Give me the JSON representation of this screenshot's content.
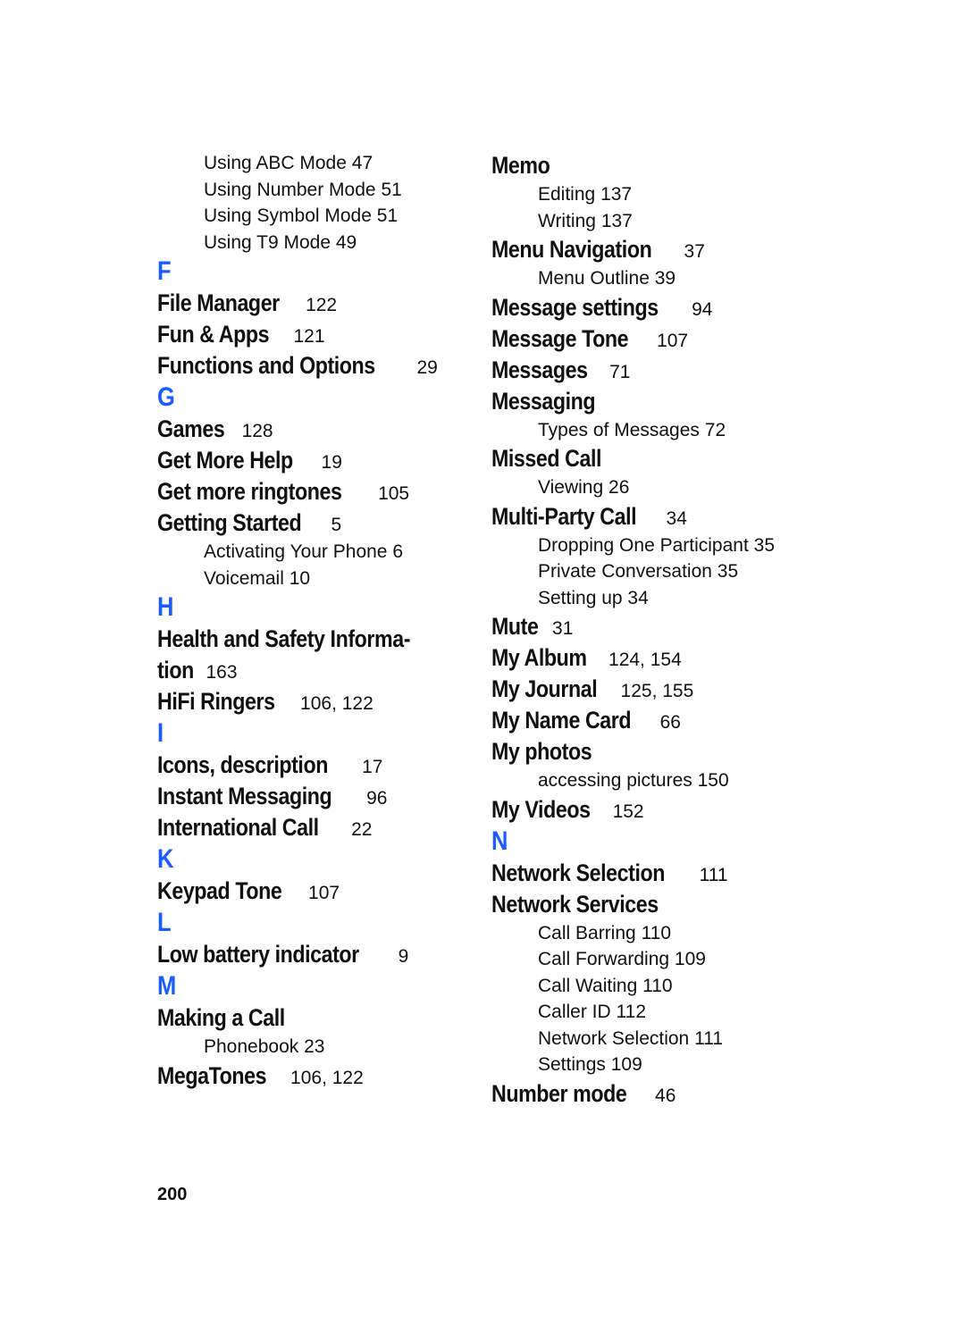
{
  "page_number": "200",
  "accent_color": "#1a5cff",
  "columns": [
    {
      "rows": [
        {
          "type": "sub",
          "term": "Using ABC Mode",
          "pages": "47"
        },
        {
          "type": "sub",
          "term": "Using Number Mode",
          "pages": "51"
        },
        {
          "type": "sub",
          "term": "Using Symbol Mode",
          "pages": "51"
        },
        {
          "type": "sub",
          "term": "Using T9 Mode",
          "pages": "49"
        },
        {
          "type": "letter",
          "term": "F"
        },
        {
          "type": "main",
          "term": "File Manager",
          "pages": "122"
        },
        {
          "type": "main",
          "term": "Fun & Apps",
          "pages": "121"
        },
        {
          "type": "main",
          "term": "Functions and Options",
          "pages": "29"
        },
        {
          "type": "letter",
          "term": "G"
        },
        {
          "type": "main",
          "term": "Games",
          "pages": "128"
        },
        {
          "type": "main",
          "term": "Get More Help",
          "pages": "19"
        },
        {
          "type": "main",
          "term": "Get more ringtones",
          "pages": "105"
        },
        {
          "type": "main",
          "term": "Getting Started",
          "pages": "5"
        },
        {
          "type": "sub",
          "term": "Activating Your Phone",
          "pages": "6"
        },
        {
          "type": "sub",
          "term": "Voicemail",
          "pages": "10"
        },
        {
          "type": "letter",
          "term": "H"
        },
        {
          "type": "main",
          "term": "Health and Safety Informa-",
          "pages": ""
        },
        {
          "type": "main",
          "term": "tion",
          "pages": "163"
        },
        {
          "type": "main",
          "term": "HiFi Ringers",
          "pages": "106, 122"
        },
        {
          "type": "letter",
          "term": "I"
        },
        {
          "type": "main",
          "term": "Icons, description",
          "pages": "17"
        },
        {
          "type": "main",
          "term": "Instant Messaging",
          "pages": "96"
        },
        {
          "type": "main",
          "term": "International Call",
          "pages": "22"
        },
        {
          "type": "letter",
          "term": "K"
        },
        {
          "type": "main",
          "term": "Keypad Tone",
          "pages": "107"
        },
        {
          "type": "letter",
          "term": "L"
        },
        {
          "type": "main",
          "term": "Low battery indicator",
          "pages": "9"
        },
        {
          "type": "letter",
          "term": "M"
        },
        {
          "type": "main",
          "term": "Making a Call",
          "pages": ""
        },
        {
          "type": "sub",
          "term": "Phonebook",
          "pages": "23"
        },
        {
          "type": "main",
          "term": "MegaTones",
          "pages": "106, 122"
        }
      ]
    },
    {
      "rows": [
        {
          "type": "main",
          "term": "Memo",
          "pages": ""
        },
        {
          "type": "sub",
          "term": "Editing",
          "pages": "137"
        },
        {
          "type": "sub",
          "term": "Writing",
          "pages": "137"
        },
        {
          "type": "main",
          "term": "Menu Navigation",
          "pages": "37"
        },
        {
          "type": "sub",
          "term": "Menu Outline",
          "pages": "39"
        },
        {
          "type": "main",
          "term": "Message settings",
          "pages": "94"
        },
        {
          "type": "main",
          "term": "Message Tone",
          "pages": "107"
        },
        {
          "type": "main",
          "term": "Messages",
          "pages": "71"
        },
        {
          "type": "main",
          "term": "Messaging",
          "pages": ""
        },
        {
          "type": "sub",
          "term": "Types of Messages",
          "pages": "72"
        },
        {
          "type": "main",
          "term": "Missed Call",
          "pages": ""
        },
        {
          "type": "sub",
          "term": "Viewing",
          "pages": "26"
        },
        {
          "type": "main",
          "term": "Multi-Party Call",
          "pages": "34"
        },
        {
          "type": "sub",
          "term": "Dropping One Participant",
          "pages": "35"
        },
        {
          "type": "sub",
          "term": "Private Conversation",
          "pages": "35"
        },
        {
          "type": "sub",
          "term": "Setting up",
          "pages": "34"
        },
        {
          "type": "main",
          "term": "Mute",
          "pages": "31"
        },
        {
          "type": "main",
          "term": "My Album",
          "pages": "124, 154"
        },
        {
          "type": "main",
          "term": "My Journal",
          "pages": "125, 155"
        },
        {
          "type": "main",
          "term": "My Name Card",
          "pages": "66"
        },
        {
          "type": "main",
          "term": "My photos",
          "pages": ""
        },
        {
          "type": "sub",
          "term": "accessing pictures",
          "pages": "150"
        },
        {
          "type": "main",
          "term": "My Videos",
          "pages": "152"
        },
        {
          "type": "letter",
          "term": "N"
        },
        {
          "type": "main",
          "term": "Network Selection",
          "pages": "111"
        },
        {
          "type": "main",
          "term": "Network Services",
          "pages": ""
        },
        {
          "type": "sub",
          "term": "Call Barring",
          "pages": "110"
        },
        {
          "type": "sub",
          "term": "Call Forwarding",
          "pages": "109"
        },
        {
          "type": "sub",
          "term": "Call Waiting",
          "pages": "110"
        },
        {
          "type": "sub",
          "term": "Caller ID",
          "pages": "112"
        },
        {
          "type": "sub",
          "term": "Network Selection",
          "pages": "111"
        },
        {
          "type": "sub",
          "term": "Settings",
          "pages": "109"
        },
        {
          "type": "main",
          "term": "Number mode",
          "pages": "46"
        }
      ]
    }
  ]
}
